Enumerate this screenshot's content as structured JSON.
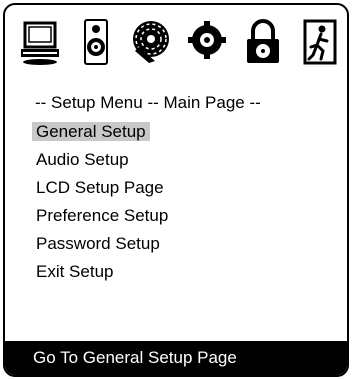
{
  "toolbar": {
    "icons": [
      {
        "name": "general-setup-icon"
      },
      {
        "name": "audio-speaker-icon"
      },
      {
        "name": "lcd-disc-icon"
      },
      {
        "name": "preference-gear-icon"
      },
      {
        "name": "password-lock-icon"
      },
      {
        "name": "exit-door-icon"
      }
    ]
  },
  "header": {
    "text": "-- Setup Menu -- Main Page --"
  },
  "menu": {
    "items": [
      {
        "label": "General Setup",
        "selected": true
      },
      {
        "label": "Audio Setup",
        "selected": false
      },
      {
        "label": "LCD Setup Page",
        "selected": false
      },
      {
        "label": "Preference Setup",
        "selected": false
      },
      {
        "label": "Password Setup",
        "selected": false
      },
      {
        "label": "Exit Setup",
        "selected": false
      }
    ]
  },
  "status": {
    "text": "Go To General Setup Page"
  },
  "colors": {
    "selected_bg": "#c8c8c8",
    "status_bg": "#000000",
    "status_fg": "#ffffff"
  }
}
